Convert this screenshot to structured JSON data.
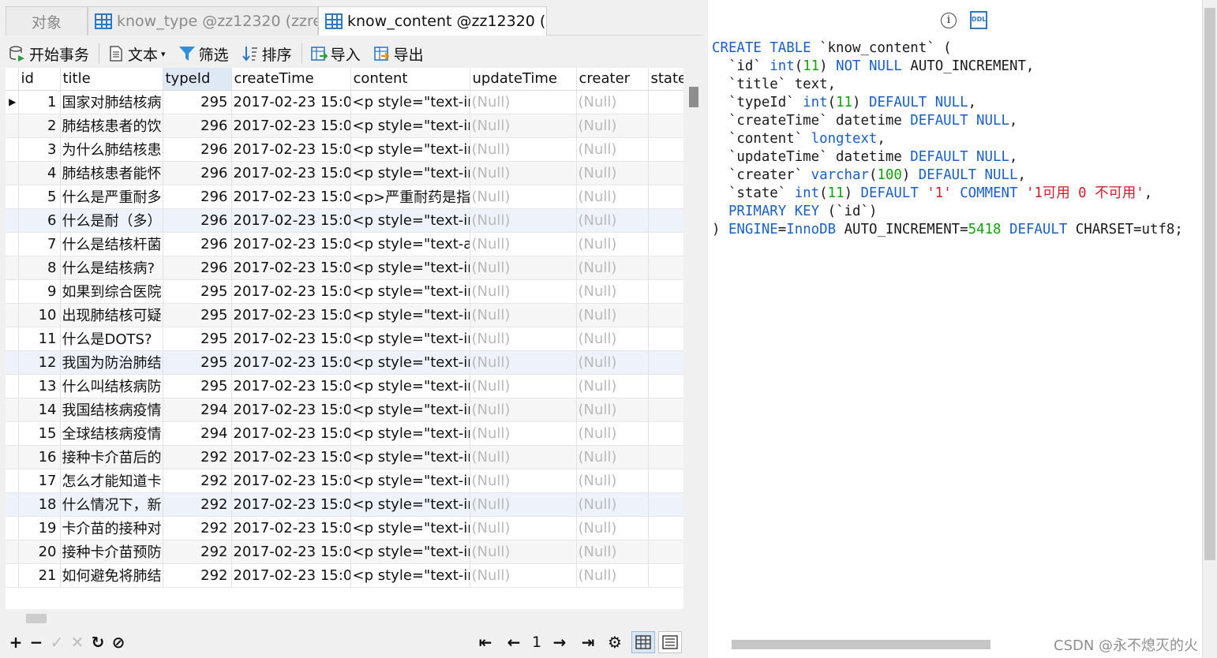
{
  "tabs": [
    {
      "label": "对象"
    },
    {
      "label": "know_type @zz12320 (zzre..."
    },
    {
      "label": "know_content @zz12320 (z..."
    }
  ],
  "toolbar": {
    "begin_tx": "开始事务",
    "text": "文本",
    "filter": "筛选",
    "sort": "排序",
    "import": "导入",
    "export": "导出"
  },
  "grid": {
    "columns": [
      "id",
      "title",
      "typeId",
      "createTime",
      "content",
      "updateTime",
      "creater",
      "state"
    ],
    "rows": [
      {
        "id": "1",
        "title": "国家对肺结核病",
        "typeId": "295",
        "createTime": "2017-02-23 15:0",
        "content": "<p style=\"text-in",
        "updateTime": "(Null)",
        "creater": "(Null)"
      },
      {
        "id": "2",
        "title": "肺结核患者的饮",
        "typeId": "296",
        "createTime": "2017-02-23 15:0",
        "content": "<p style=\"text-in",
        "updateTime": "(Null)",
        "creater": "(Null)"
      },
      {
        "id": "3",
        "title": "为什么肺结核患",
        "typeId": "296",
        "createTime": "2017-02-23 15:0",
        "content": "<p style=\"text-in",
        "updateTime": "(Null)",
        "creater": "(Null)"
      },
      {
        "id": "4",
        "title": "肺结核患者能怀",
        "typeId": "296",
        "createTime": "2017-02-23 15:0",
        "content": "<p style=\"text-in",
        "updateTime": "(Null)",
        "creater": "(Null)"
      },
      {
        "id": "5",
        "title": "什么是严重耐多",
        "typeId": "296",
        "createTime": "2017-02-23 15:0",
        "content": "<p>严重耐药是指",
        "updateTime": "(Null)",
        "creater": "(Null)"
      },
      {
        "id": "6",
        "title": "什么是耐（多）",
        "typeId": "296",
        "createTime": "2017-02-23 15:0",
        "content": "<p style=\"text-in",
        "updateTime": "(Null)",
        "creater": "(Null)"
      },
      {
        "id": "7",
        "title": "什么是结核杆菌",
        "typeId": "296",
        "createTime": "2017-02-23 15:0",
        "content": "<p style=\"text-al",
        "updateTime": "(Null)",
        "creater": "(Null)"
      },
      {
        "id": "8",
        "title": "什么是结核病?",
        "typeId": "296",
        "createTime": "2017-02-23 15:0",
        "content": "<p style=\"text-in",
        "updateTime": "(Null)",
        "creater": "(Null)"
      },
      {
        "id": "9",
        "title": "如果到综合医院",
        "typeId": "295",
        "createTime": "2017-02-23 15:0",
        "content": "<p style=\"text-in",
        "updateTime": "(Null)",
        "creater": "(Null)"
      },
      {
        "id": "10",
        "title": "出现肺结核可疑",
        "typeId": "295",
        "createTime": "2017-02-23 15:0",
        "content": "<p style=\"text-in",
        "updateTime": "(Null)",
        "creater": "(Null)"
      },
      {
        "id": "11",
        "title": "什么是DOTS?",
        "typeId": "295",
        "createTime": "2017-02-23 15:0",
        "content": "<p style=\"text-in",
        "updateTime": "(Null)",
        "creater": "(Null)"
      },
      {
        "id": "12",
        "title": "我国为防治肺结",
        "typeId": "295",
        "createTime": "2017-02-23 15:0",
        "content": "<p style=\"text-in",
        "updateTime": "(Null)",
        "creater": "(Null)"
      },
      {
        "id": "13",
        "title": "什么叫结核病防",
        "typeId": "295",
        "createTime": "2017-02-23 15:0",
        "content": "<p style=\"text-in",
        "updateTime": "(Null)",
        "creater": "(Null)"
      },
      {
        "id": "14",
        "title": "我国结核病疫情",
        "typeId": "294",
        "createTime": "2017-02-23 15:0",
        "content": "<p style=\"text-in",
        "updateTime": "(Null)",
        "creater": "(Null)"
      },
      {
        "id": "15",
        "title": "全球结核病疫情",
        "typeId": "294",
        "createTime": "2017-02-23 15:0",
        "content": "<p style=\"text-in",
        "updateTime": "(Null)",
        "creater": "(Null)"
      },
      {
        "id": "16",
        "title": "接种卡介苗后的",
        "typeId": "292",
        "createTime": "2017-02-23 15:0",
        "content": "<p style=\"text-in",
        "updateTime": "(Null)",
        "creater": "(Null)"
      },
      {
        "id": "17",
        "title": "怎么才能知道卡",
        "typeId": "292",
        "createTime": "2017-02-23 15:0",
        "content": "<p style=\"text-in",
        "updateTime": "(Null)",
        "creater": "(Null)"
      },
      {
        "id": "18",
        "title": "什么情况下，新",
        "typeId": "292",
        "createTime": "2017-02-23 15:0",
        "content": "<p style=\"text-in",
        "updateTime": "(Null)",
        "creater": "(Null)"
      },
      {
        "id": "19",
        "title": "卡介苗的接种对",
        "typeId": "292",
        "createTime": "2017-02-23 15:0",
        "content": "<p style=\"text-in",
        "updateTime": "(Null)",
        "creater": "(Null)"
      },
      {
        "id": "20",
        "title": "接种卡介苗预防",
        "typeId": "292",
        "createTime": "2017-02-23 15:0",
        "content": "<p style=\"text-in",
        "updateTime": "(Null)",
        "creater": "(Null)"
      },
      {
        "id": "21",
        "title": "如何避免将肺结",
        "typeId": "292",
        "createTime": "2017-02-23 15:0",
        "content": "<p style=\"text-in",
        "updateTime": "(Null)",
        "creater": "(Null)"
      }
    ],
    "selected_column": "typeId",
    "current_row": 1
  },
  "pager": {
    "page": "1"
  },
  "ddl": {
    "lines": [
      [
        {
          "t": "CREATE TABLE",
          "c": "kw"
        },
        {
          "t": " `know_content` (",
          "c": ""
        }
      ],
      [
        {
          "t": "  `id` ",
          "c": ""
        },
        {
          "t": "int",
          "c": "kw"
        },
        {
          "t": "(",
          "c": ""
        },
        {
          "t": "11",
          "c": "nm"
        },
        {
          "t": ") ",
          "c": ""
        },
        {
          "t": "NOT NULL",
          "c": "kw"
        },
        {
          "t": " AUTO_INCREMENT,",
          "c": ""
        }
      ],
      [
        {
          "t": "  `title` text,",
          "c": ""
        }
      ],
      [
        {
          "t": "  `typeId` ",
          "c": ""
        },
        {
          "t": "int",
          "c": "kw"
        },
        {
          "t": "(",
          "c": ""
        },
        {
          "t": "11",
          "c": "nm"
        },
        {
          "t": ") ",
          "c": ""
        },
        {
          "t": "DEFAULT NULL",
          "c": "kw"
        },
        {
          "t": ",",
          "c": ""
        }
      ],
      [
        {
          "t": "  `createTime` datetime ",
          "c": ""
        },
        {
          "t": "DEFAULT NULL",
          "c": "kw"
        },
        {
          "t": ",",
          "c": ""
        }
      ],
      [
        {
          "t": "  `content` ",
          "c": ""
        },
        {
          "t": "longtext",
          "c": "kw"
        },
        {
          "t": ",",
          "c": ""
        }
      ],
      [
        {
          "t": "  `updateTime` datetime ",
          "c": ""
        },
        {
          "t": "DEFAULT NULL",
          "c": "kw"
        },
        {
          "t": ",",
          "c": ""
        }
      ],
      [
        {
          "t": "  `creater` ",
          "c": ""
        },
        {
          "t": "varchar",
          "c": "kw"
        },
        {
          "t": "(",
          "c": ""
        },
        {
          "t": "100",
          "c": "nm"
        },
        {
          "t": ") ",
          "c": ""
        },
        {
          "t": "DEFAULT NULL",
          "c": "kw"
        },
        {
          "t": ",",
          "c": ""
        }
      ],
      [
        {
          "t": "  `state` ",
          "c": ""
        },
        {
          "t": "int",
          "c": "kw"
        },
        {
          "t": "(",
          "c": ""
        },
        {
          "t": "11",
          "c": "nm"
        },
        {
          "t": ") ",
          "c": ""
        },
        {
          "t": "DEFAULT",
          "c": "kw"
        },
        {
          "t": " ",
          "c": ""
        },
        {
          "t": "'1'",
          "c": "st"
        },
        {
          "t": " ",
          "c": ""
        },
        {
          "t": "COMMENT",
          "c": "kw"
        },
        {
          "t": " ",
          "c": ""
        },
        {
          "t": "'1可用 0 不可用'",
          "c": "st"
        },
        {
          "t": ",",
          "c": ""
        }
      ],
      [
        {
          "t": "  ",
          "c": ""
        },
        {
          "t": "PRIMARY KEY",
          "c": "kw"
        },
        {
          "t": " (`id`)",
          "c": ""
        }
      ],
      [
        {
          "t": ") ",
          "c": ""
        },
        {
          "t": "ENGINE",
          "c": "kw"
        },
        {
          "t": "=",
          "c": ""
        },
        {
          "t": "InnoDB",
          "c": "kw"
        },
        {
          "t": " AUTO_INCREMENT=",
          "c": ""
        },
        {
          "t": "5418",
          "c": "nm"
        },
        {
          "t": " ",
          "c": ""
        },
        {
          "t": "DEFAULT",
          "c": "kw"
        },
        {
          "t": " CHARSET=utf8;",
          "c": ""
        }
      ]
    ]
  },
  "watermark": "CSDN @永不熄灭的火",
  "colors": {
    "keyword": "#1a5fc4",
    "number": "#13a10e",
    "string": "#d11a2a",
    "null": "#b9b9b9",
    "accent": "#2f78c4"
  }
}
